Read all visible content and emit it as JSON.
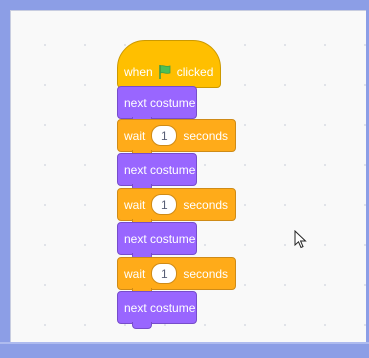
{
  "script": {
    "hat_block": {
      "before_flag": "when",
      "flag_icon": "green-flag-icon",
      "after_flag": "clicked"
    },
    "blocks": [
      {
        "kind": "looks",
        "label": "next costume"
      },
      {
        "kind": "control",
        "label_before": "wait",
        "value": "1",
        "label_after": "seconds"
      },
      {
        "kind": "looks",
        "label": "next costume"
      },
      {
        "kind": "control",
        "label_before": "wait",
        "value": "1",
        "label_after": "seconds"
      },
      {
        "kind": "looks",
        "label": "next costume"
      },
      {
        "kind": "control",
        "label_before": "wait",
        "value": "1",
        "label_after": "seconds"
      },
      {
        "kind": "looks",
        "label": "next costume"
      }
    ]
  },
  "colors": {
    "frame": "#8c9ee6",
    "workspace": "#f9f9f9",
    "event_block": "#ffbf00",
    "looks_block": "#9966ff",
    "control_block": "#ffab19",
    "flag": "#4cbf56"
  },
  "cursor_icon": "mouse-pointer-icon"
}
